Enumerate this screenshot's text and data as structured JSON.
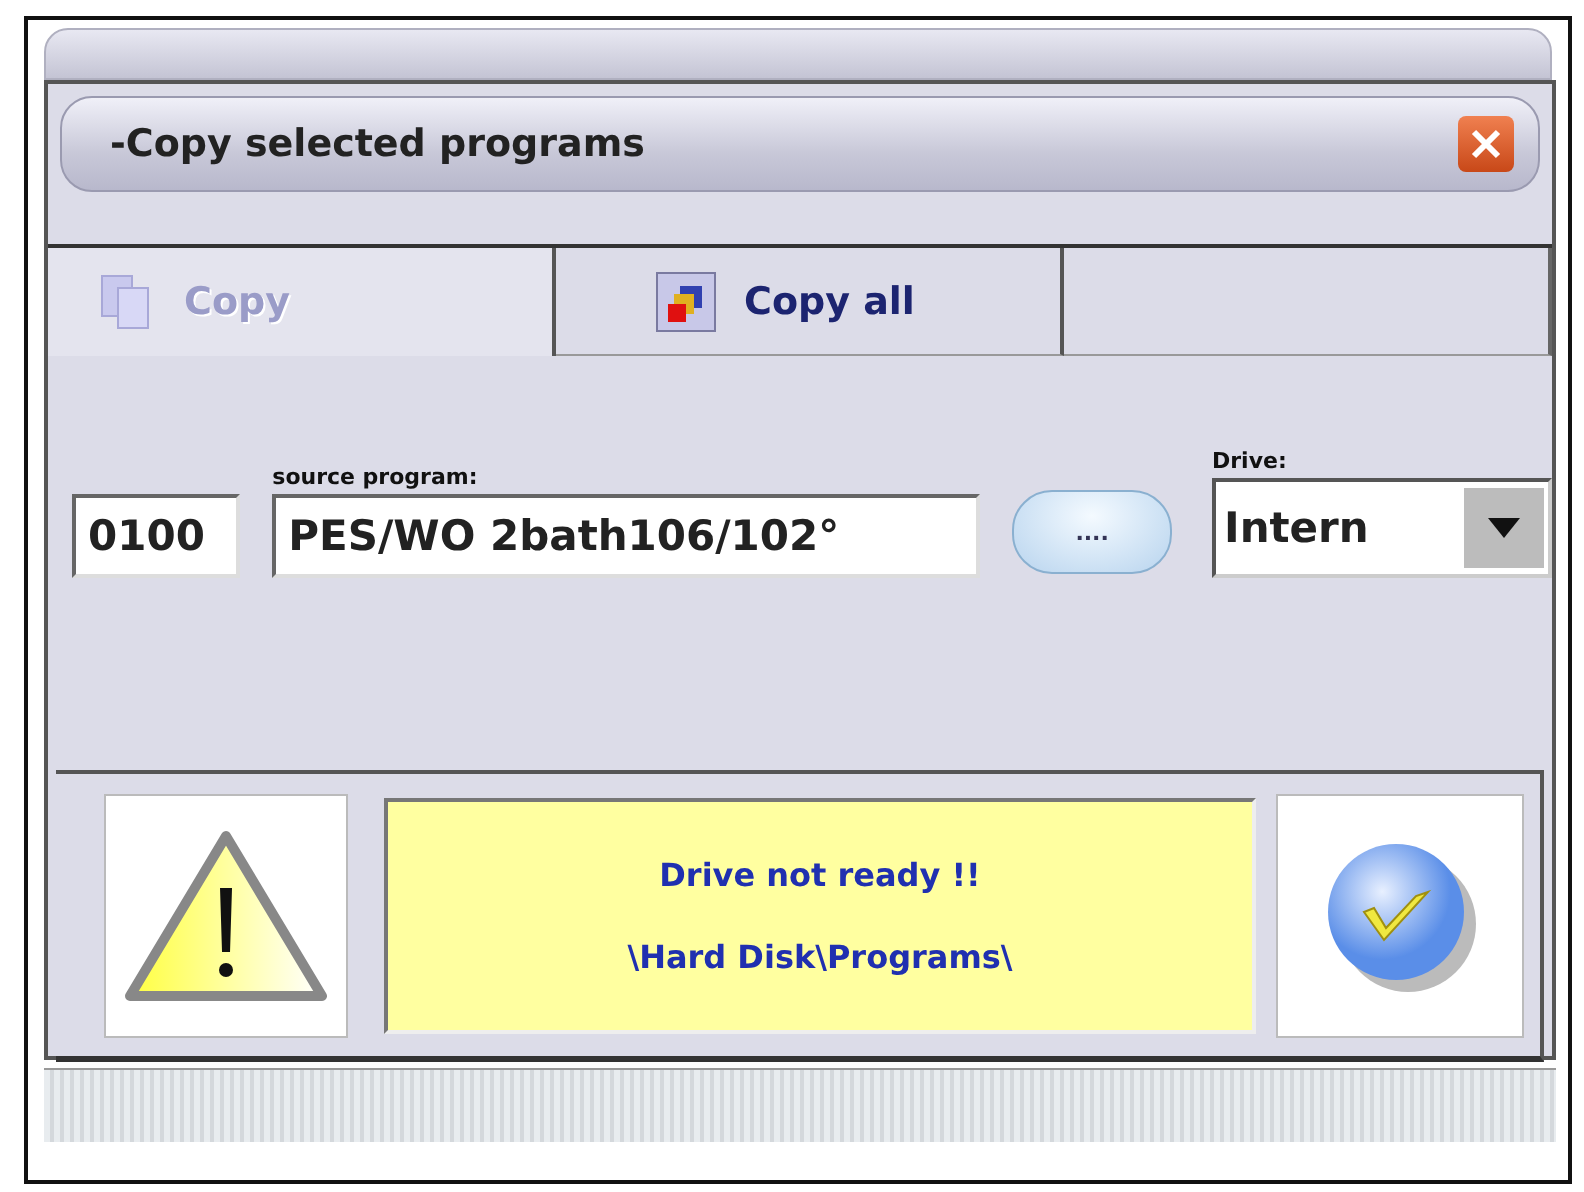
{
  "window": {
    "title": "-Copy selected programs"
  },
  "tabs": [
    {
      "label": "Copy",
      "selected": true
    },
    {
      "label": "Copy all",
      "selected": false
    }
  ],
  "source": {
    "number": "0100",
    "label": "source program:",
    "value": "PES/WO 2bath106/102°",
    "browse_button": "....",
    "drive_label": "Drive:",
    "drive": "Intern"
  },
  "alert": {
    "message": "Drive not ready !!",
    "path": "\\Hard Disk\\Programs\\"
  }
}
